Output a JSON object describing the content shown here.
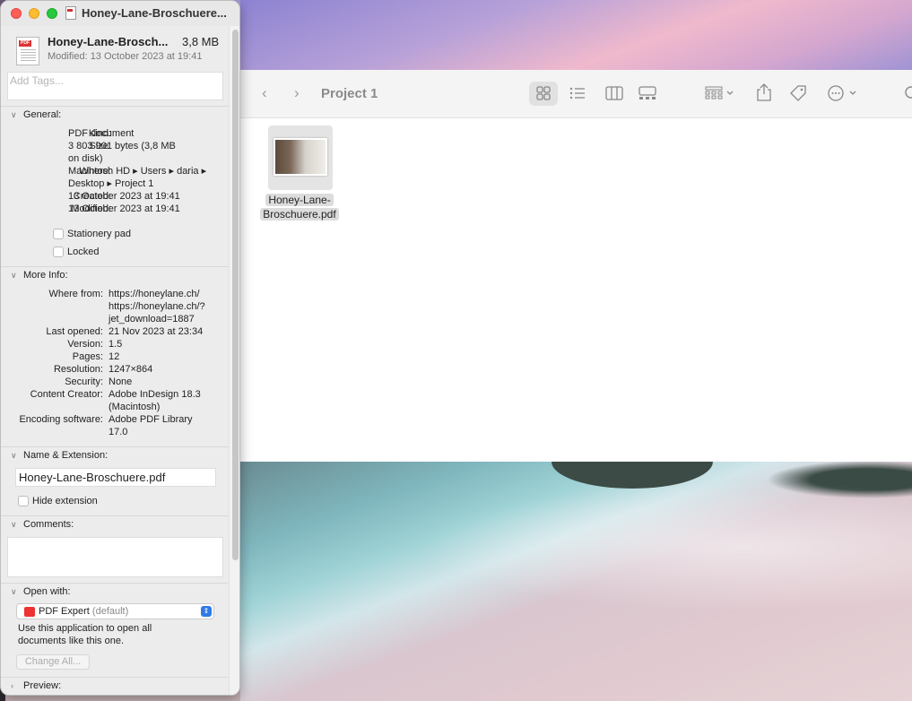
{
  "info": {
    "window_title": "Honey-Lane-Broschuere...",
    "header": {
      "name": "Honey-Lane-Brosch...",
      "size": "3,8 MB",
      "modified": "Modified: 13 October 2023 at 19:41"
    },
    "tags_placeholder": "Add Tags...",
    "general": {
      "title": "General:",
      "kind_label": "Kind:",
      "kind_value": "PDF document",
      "size_label": "Size:",
      "size_value_1": "3 803 901 bytes (3,8 MB",
      "size_value_2": "on disk)",
      "where_label": "Where:",
      "where_value_1": "Macintosh HD ▸ Users ▸ daria ▸",
      "where_value_2": "Desktop ▸ Project 1",
      "created_label": "Created:",
      "created_value": "13 October 2023 at 19:41",
      "modified_label": "Modified:",
      "modified_value": "13 October 2023 at 19:41",
      "stationery": "Stationery pad",
      "locked": "Locked"
    },
    "more_info": {
      "title": "More Info:",
      "where_from_label": "Where from:",
      "where_from_1": "https://honeylane.ch/",
      "where_from_2": "https://honeylane.ch/?",
      "where_from_3": "jet_download=1887",
      "last_opened_label": "Last opened:",
      "last_opened_value": "21 Nov 2023 at 23:34",
      "version_label": "Version:",
      "version_value": "1.5",
      "pages_label": "Pages:",
      "pages_value": "12",
      "resolution_label": "Resolution:",
      "resolution_value": "1247×864",
      "security_label": "Security:",
      "security_value": "None",
      "creator_label": "Content Creator:",
      "creator_value_1": "Adobe InDesign 18.3",
      "creator_value_2": "(Macintosh)",
      "encoding_label": "Encoding software:",
      "encoding_value_1": "Adobe PDF Library",
      "encoding_value_2": "17.0"
    },
    "name_ext": {
      "title": "Name & Extension:",
      "value": "Honey-Lane-Broschuere.pdf",
      "hide_ext": "Hide extension"
    },
    "comments": {
      "title": "Comments:"
    },
    "open_with": {
      "title": "Open with:",
      "app": "PDF Expert",
      "default": "(default)",
      "desc_1": "Use this application to open all",
      "desc_2": "documents like this one.",
      "change_all": "Change All..."
    },
    "preview": {
      "title": "Preview:"
    }
  },
  "finder": {
    "title": "Project 1",
    "file_name_1": "Honey-Lane-",
    "file_name_2": "Broschuere.pdf"
  }
}
